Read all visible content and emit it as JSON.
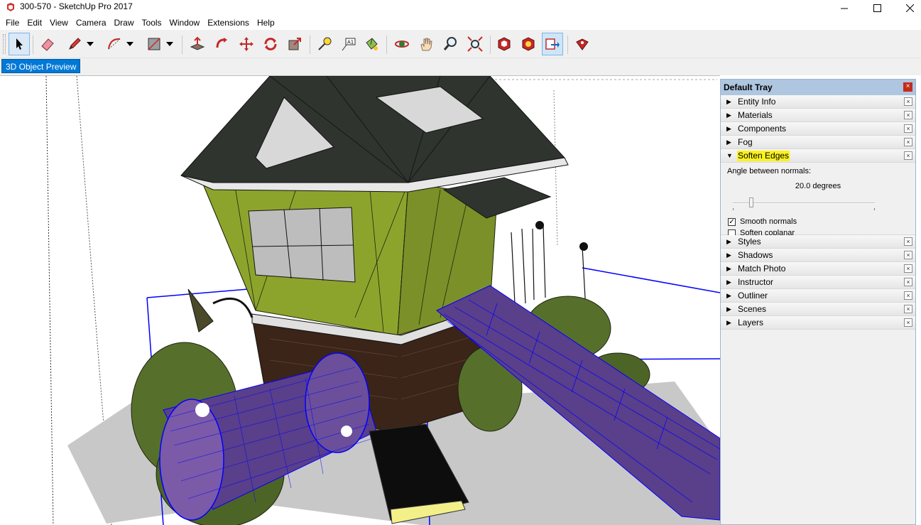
{
  "window": {
    "title": "300-570 - SketchUp Pro 2017",
    "minimize_glyph": "—",
    "maximize_glyph": "☐",
    "close_glyph": "✕"
  },
  "menu": [
    "File",
    "Edit",
    "View",
    "Camera",
    "Draw",
    "Tools",
    "Window",
    "Extensions",
    "Help"
  ],
  "toolbar": {
    "icons": [
      "select-icon",
      "eraser-icon",
      "pencil-icon",
      "arc-icon",
      "rectangle-icon",
      "push-pull-icon",
      "follow-me-icon",
      "move-icon",
      "rotate-icon",
      "scale-icon",
      "tape-measure-icon",
      "text-icon",
      "paint-bucket-icon",
      "orbit-icon",
      "pan-icon",
      "zoom-icon",
      "zoom-extents-icon",
      "warehouse-icon",
      "extension-warehouse-icon",
      "send-to-layout-icon",
      "extension-manager-icon"
    ],
    "active": "send-to-layout-icon"
  },
  "scene_tab": "3D Object Preview",
  "tray": {
    "title": "Default Tray",
    "close_glyph": "×",
    "panels_top": [
      {
        "label": "Entity Info",
        "expanded": false
      },
      {
        "label": "Materials",
        "expanded": false
      },
      {
        "label": "Components",
        "expanded": false
      },
      {
        "label": "Fog",
        "expanded": false
      }
    ],
    "soften": {
      "label": "Soften Edges",
      "expanded": true,
      "highlight_color": "#fbf21e",
      "angle_label": "Angle between normals:",
      "angle_value": "20.0  degrees",
      "angle_fraction": 0.11,
      "smooth_normals_label": "Smooth normals",
      "smooth_normals_checked": true,
      "soften_coplanar_label": "Soften coplanar",
      "soften_coplanar_checked": false
    },
    "panels_bottom": [
      {
        "label": "Styles"
      },
      {
        "label": "Shadows"
      },
      {
        "label": "Match Photo"
      },
      {
        "label": "Instructor"
      },
      {
        "label": "Outliner"
      },
      {
        "label": "Scenes"
      },
      {
        "label": "Layers"
      }
    ],
    "row_close_glyph": "×",
    "arrow_collapsed": "▶",
    "arrow_expanded": "▼"
  },
  "colors": {
    "house_wall": "#8da42c",
    "roof": "#2f342f",
    "brick": "#3b2418",
    "selection": "#0000ff",
    "slide": "#5a3f8a",
    "bushes": "#56702c",
    "shadow": "#c8c8c8"
  }
}
